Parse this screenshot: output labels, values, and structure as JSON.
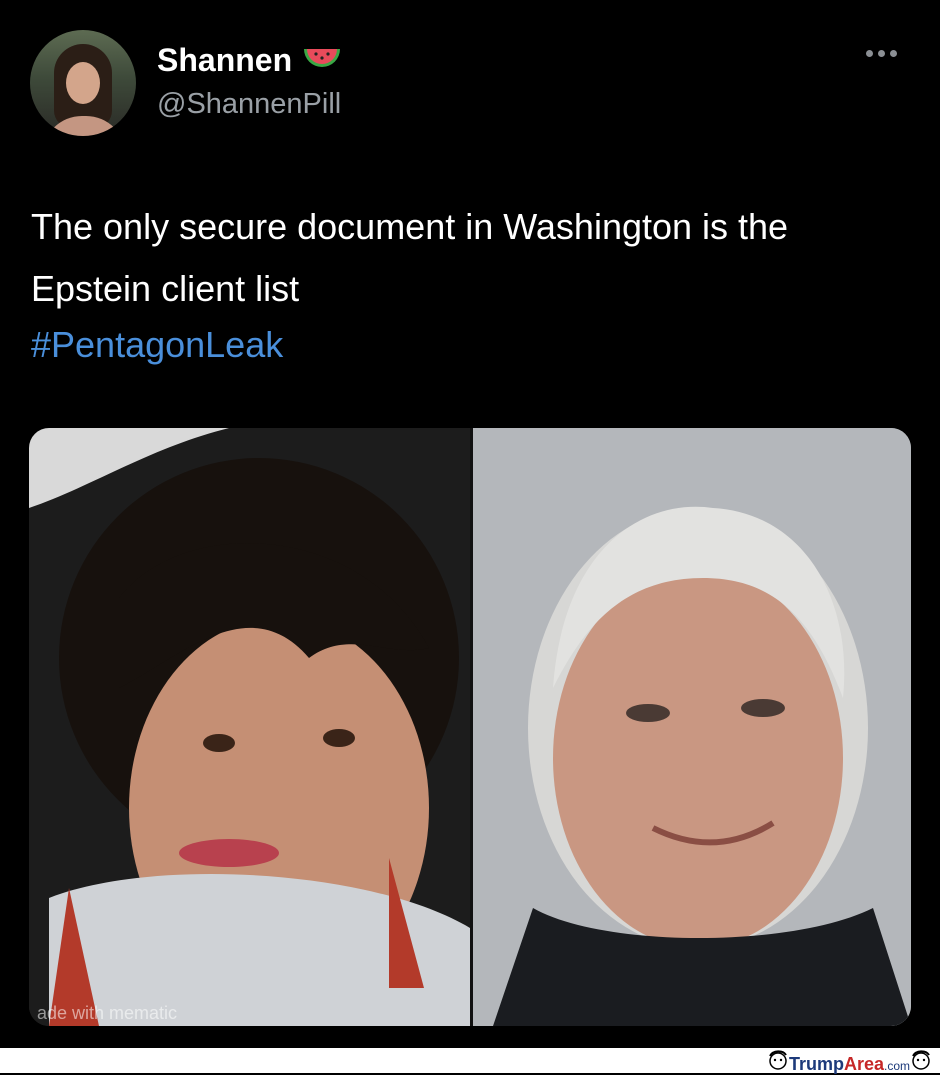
{
  "user": {
    "display_name": "Shannen",
    "emoji": "🍉",
    "handle": "@ShannenPill"
  },
  "tweet": {
    "text": "The only secure document in Washington is the Epstein client list",
    "hashtag": "#PentagonLeak"
  },
  "media": {
    "watermark": "ade with mematic"
  },
  "footer": {
    "logo_trump": "Trump",
    "logo_area": "Area",
    "logo_dotcom": ".com"
  },
  "colors": {
    "background": "#000000",
    "hashtag": "#4a8fdb",
    "handle": "#9aa0a6"
  }
}
